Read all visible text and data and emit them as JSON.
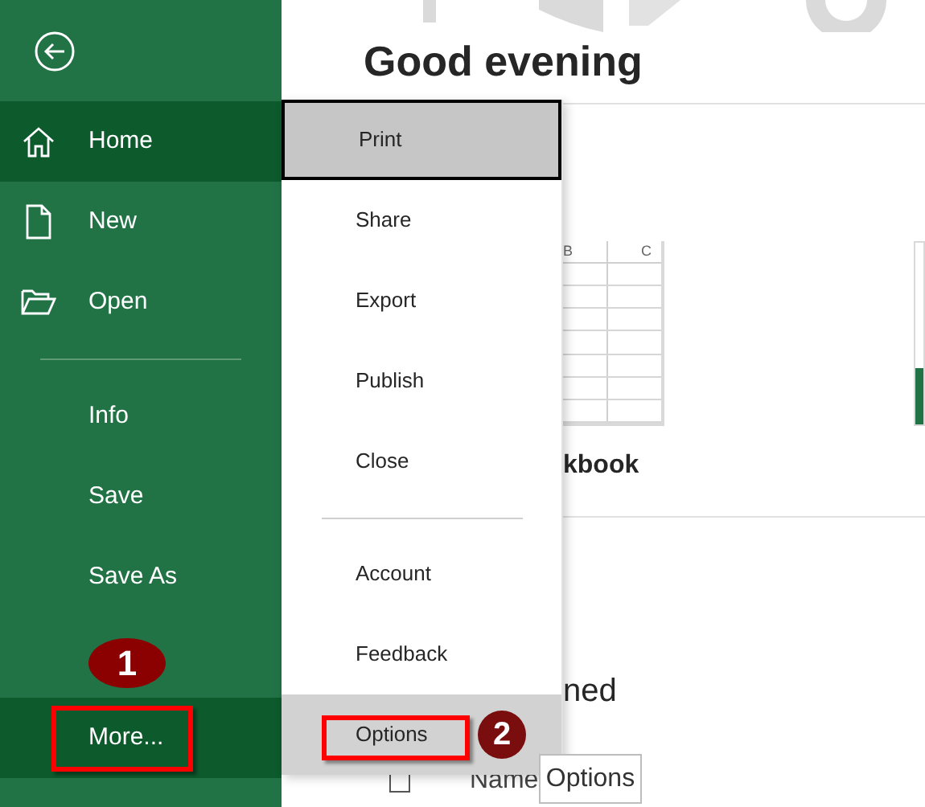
{
  "sidebar": {
    "items": [
      {
        "label": "Home",
        "kind": "home",
        "selected": true,
        "boxed": false
      },
      {
        "label": "New",
        "kind": "new",
        "selected": false,
        "boxed": false
      },
      {
        "label": "Open",
        "kind": "open",
        "selected": false,
        "boxed": false
      },
      {
        "label": "Info",
        "kind": "text",
        "selected": false,
        "boxed": false
      },
      {
        "label": "Save",
        "kind": "text",
        "selected": false,
        "boxed": false
      },
      {
        "label": "Save As",
        "kind": "text",
        "selected": false,
        "boxed": false
      },
      {
        "label": "More...",
        "kind": "text",
        "selected": true,
        "boxed": true
      }
    ]
  },
  "menu": {
    "items": [
      {
        "label": "Print",
        "selected": true,
        "highlighted": false,
        "boxed": false
      },
      {
        "label": "Share",
        "selected": false,
        "highlighted": false,
        "boxed": false
      },
      {
        "label": "Export",
        "selected": false,
        "highlighted": false,
        "boxed": false
      },
      {
        "label": "Publish",
        "selected": false,
        "highlighted": false,
        "boxed": false
      },
      {
        "label": "Close",
        "selected": false,
        "highlighted": false,
        "boxed": false
      },
      {
        "label": "Account",
        "selected": false,
        "highlighted": false,
        "boxed": false
      },
      {
        "label": "Feedback",
        "selected": false,
        "highlighted": false,
        "boxed": false
      },
      {
        "label": "Options",
        "selected": false,
        "highlighted": true,
        "boxed": true
      }
    ]
  },
  "greeting": "Good evening",
  "template": {
    "column_headers": [
      "B",
      "C"
    ],
    "label": "kbook"
  },
  "section_heading": "ned",
  "list_header": {
    "checked": false,
    "label": "Name"
  },
  "tooltip": "Options",
  "annotations": [
    {
      "number": "1"
    },
    {
      "number": "2"
    }
  ]
}
